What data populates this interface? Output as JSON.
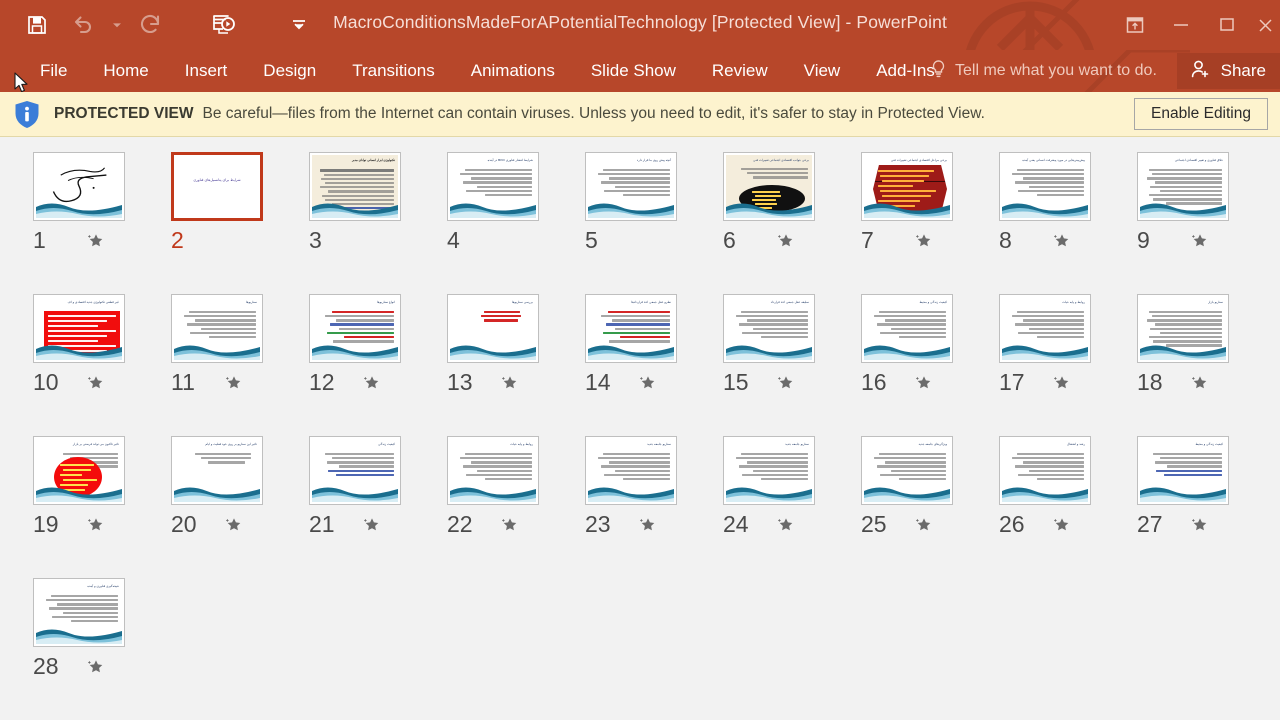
{
  "window": {
    "title": "MacroConditionsMadeForAPotentialTechnology [Protected View] - PowerPoint",
    "brand_color": "#b7472a",
    "accent_color": "#c0391b"
  },
  "quick_access": {
    "items": [
      {
        "name": "save-icon",
        "label": "Save",
        "state": "enabled"
      },
      {
        "name": "undo-icon",
        "label": "Undo",
        "state": "disabled"
      },
      {
        "name": "undo-dropdown-icon",
        "label": "Undo options",
        "state": "disabled"
      },
      {
        "name": "redo-icon",
        "label": "Redo",
        "state": "disabled"
      },
      {
        "name": "start-slideshow-icon",
        "label": "Start From Beginning",
        "state": "enabled"
      },
      {
        "name": "customize-quick-access-icon",
        "label": "Customize Quick Access Toolbar",
        "state": "enabled"
      }
    ]
  },
  "window_controls": [
    {
      "name": "ribbon-display-options-icon",
      "label": "Ribbon Display Options"
    },
    {
      "name": "minimize-icon",
      "label": "Minimize"
    },
    {
      "name": "restore-icon",
      "label": "Restore Down"
    },
    {
      "name": "close-icon",
      "label": "Close"
    }
  ],
  "ribbon": {
    "tabs": [
      {
        "label": "File"
      },
      {
        "label": "Home"
      },
      {
        "label": "Insert"
      },
      {
        "label": "Design"
      },
      {
        "label": "Transitions"
      },
      {
        "label": "Animations"
      },
      {
        "label": "Slide Show"
      },
      {
        "label": "Review"
      },
      {
        "label": "View"
      },
      {
        "label": "Add-Ins"
      }
    ],
    "tell_me": "Tell me what you want to do.",
    "share_label": "Share"
  },
  "protected_view": {
    "badge": "PROTECTED VIEW",
    "message": "Be careful—files from the Internet can contain viruses. Unless you need to edit, it's safer to stay in Protected View.",
    "enable_button": "Enable Editing",
    "icon": "info-icon"
  },
  "slides": [
    {
      "number": "1",
      "starred": true,
      "selected": false,
      "variant": "calligraphy"
    },
    {
      "number": "2",
      "starred": false,
      "selected": true,
      "variant": "title-only",
      "title": "شرایط برای پتانسیل‌های فناوری"
    },
    {
      "number": "3",
      "starred": false,
      "selected": false,
      "variant": "dense-cream",
      "title": "تکنولوژی ابزار انسانی توانای مدبر"
    },
    {
      "number": "4",
      "starred": false,
      "selected": false,
      "variant": "text",
      "title": "شرایط انتشار فناوری BKD در آینده"
    },
    {
      "number": "5",
      "starred": false,
      "selected": false,
      "variant": "text",
      "title": "آنچه پیش روی ما قرار دارد"
    },
    {
      "number": "6",
      "starred": true,
      "selected": false,
      "variant": "ellipse-cream",
      "title": "برخی جوانب اقتصادی اجتماعی تغییرات فنی"
    },
    {
      "number": "7",
      "starred": true,
      "selected": false,
      "variant": "hexagon",
      "title": "برخی مراحل اقتصادی اجتماعی تغییرات فنی"
    },
    {
      "number": "8",
      "starred": true,
      "selected": false,
      "variant": "text",
      "title": "پیش‌بینی‌هایی در مورد پیشرفت انسانی یعنی آینده"
    },
    {
      "number": "9",
      "starred": true,
      "selected": false,
      "variant": "text-dense",
      "title": "خلاق فناوری و تغییر اقتصادی اجتماعی"
    },
    {
      "number": "10",
      "starred": true,
      "selected": false,
      "variant": "red-rect",
      "title": "غیر قطعی تکنولوژی جدید اقتصادی و اف"
    },
    {
      "number": "11",
      "starred": true,
      "selected": false,
      "variant": "text",
      "title": "سناریوها"
    },
    {
      "number": "12",
      "starred": true,
      "selected": false,
      "variant": "colorful",
      "title": "انواع سناریوها"
    },
    {
      "number": "13",
      "starred": true,
      "selected": false,
      "variant": "sparse-red",
      "title": "بررسی سناریوها"
    },
    {
      "number": "14",
      "starred": true,
      "selected": false,
      "variant": "colorful",
      "title": "نظرو عقل جمعی اخذ قراردادها"
    },
    {
      "number": "15",
      "starred": true,
      "selected": false,
      "variant": "text",
      "title": "سلیقه عقل جمعی اخذ قرارداد"
    },
    {
      "number": "16",
      "starred": true,
      "selected": false,
      "variant": "text",
      "title": "کیفیت زندگی و محیط"
    },
    {
      "number": "17",
      "starred": true,
      "selected": false,
      "variant": "text",
      "title": "روابط و پایه حیات"
    },
    {
      "number": "18",
      "starred": true,
      "selected": false,
      "variant": "text-dense",
      "title": "سناریو بازار"
    },
    {
      "number": "19",
      "starred": true,
      "selected": false,
      "variant": "red-circle",
      "title": "تاثیر تاکنون می تواند فرصتی بر بازار"
    },
    {
      "number": "20",
      "starred": true,
      "selected": false,
      "variant": "sparse",
      "title": "تاثیر این سناریو بر روی خود فعلیت و ایام"
    },
    {
      "number": "21",
      "starred": true,
      "selected": false,
      "variant": "text-blue",
      "title": "کیفیت زندگی"
    },
    {
      "number": "22",
      "starred": true,
      "selected": false,
      "variant": "text",
      "title": "روابط و پایه حیات"
    },
    {
      "number": "23",
      "starred": true,
      "selected": false,
      "variant": "text",
      "title": "سناریو جامعه جدید"
    },
    {
      "number": "24",
      "starred": true,
      "selected": false,
      "variant": "text",
      "title": "سناریو جامعه جدید"
    },
    {
      "number": "25",
      "starred": true,
      "selected": false,
      "variant": "text",
      "title": "ویژگی‌های جامعه جدید"
    },
    {
      "number": "26",
      "starred": true,
      "selected": false,
      "variant": "text",
      "title": "رشد و اشتغال"
    },
    {
      "number": "27",
      "starred": true,
      "selected": false,
      "variant": "text-blue",
      "title": "کیفیت زندگی و محیط"
    },
    {
      "number": "28",
      "starred": true,
      "selected": false,
      "variant": "text",
      "title": "نتیجه‌گیری فناوری و آینده"
    }
  ]
}
